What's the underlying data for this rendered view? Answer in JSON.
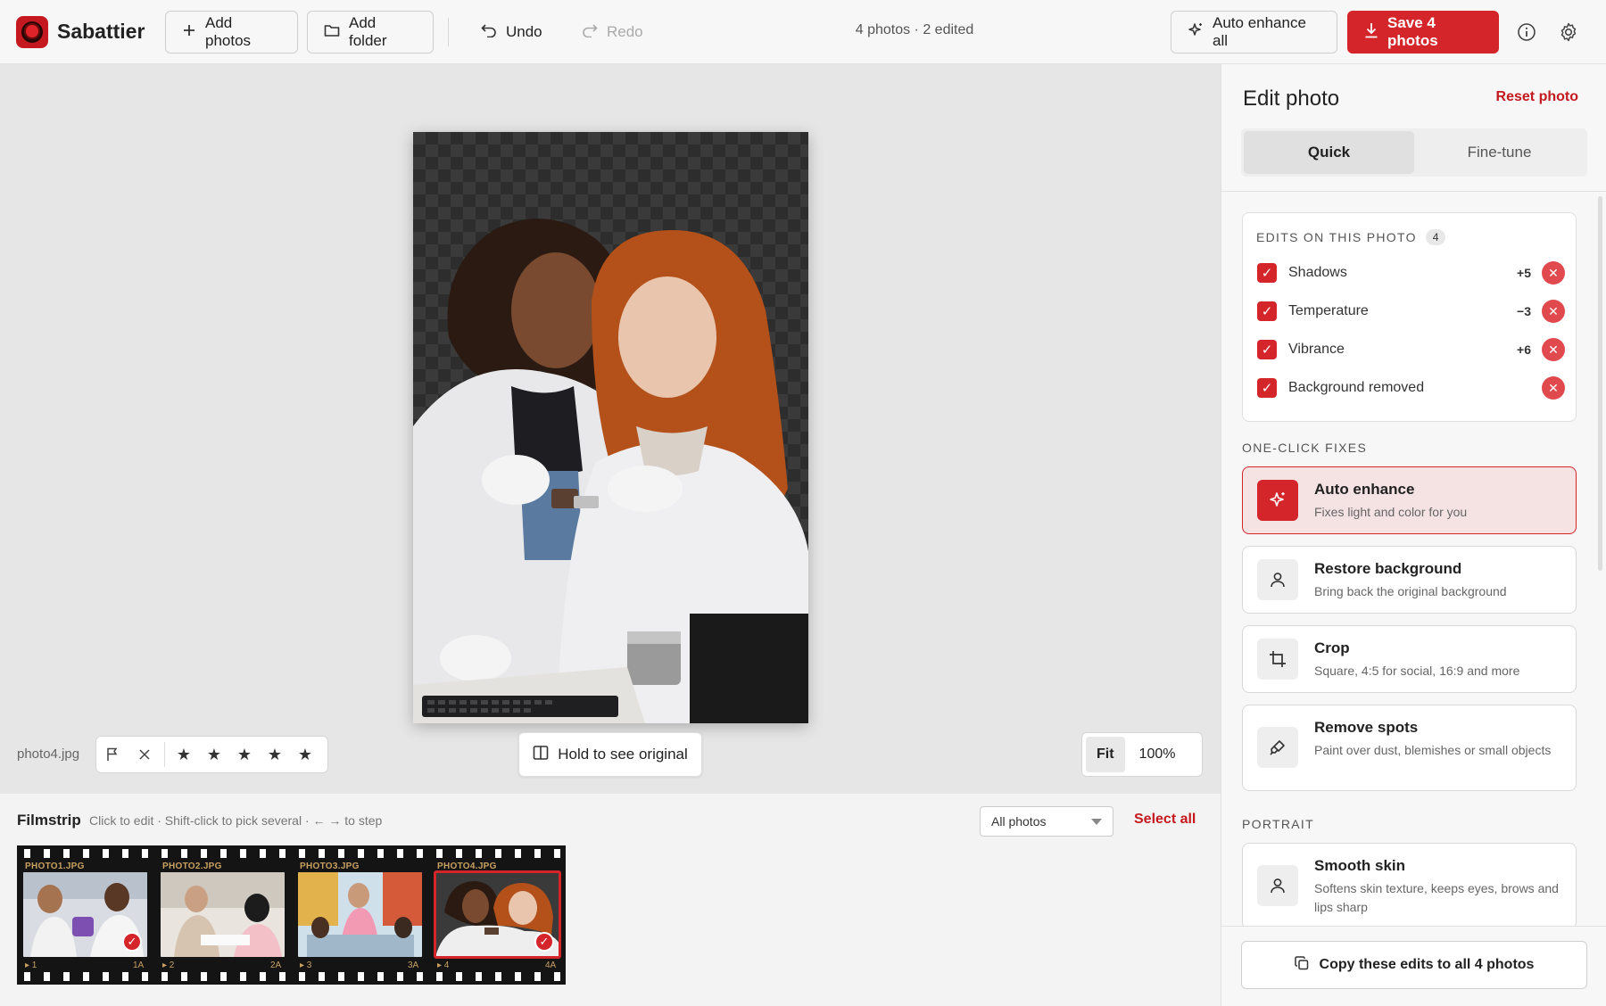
{
  "app": {
    "name": "Sabattier"
  },
  "toolbar": {
    "add_photos": "Add photos",
    "add_folder": "Add folder",
    "undo": "Undo",
    "redo": "Redo",
    "status": "4 photos · 2 edited",
    "auto_enhance_all": "Auto enhance all",
    "save": "Save 4 photos",
    "icons": {
      "add": "plus-icon",
      "folder": "folder-icon",
      "undo": "undo-icon",
      "redo": "redo-icon",
      "auto": "sparkle-icon",
      "save": "download-icon",
      "info": "info-icon",
      "settings": "gear-icon"
    }
  },
  "canvas": {
    "filename": "photo4.jpg",
    "hold_button": "Hold to see original",
    "zoom": {
      "fit": "Fit",
      "percent": "100%"
    },
    "rating": {
      "stars": [
        "★",
        "★",
        "★",
        "★",
        "★"
      ],
      "flag_icon": "flag-icon",
      "reject_icon": "close-icon"
    }
  },
  "filmstrip": {
    "title": "Filmstrip",
    "hint": "Click to edit · Shift-click to pick several · ← → to step",
    "filter": "All photos",
    "select_all": "Select all",
    "frames": [
      {
        "label": "PHOTO1.JPG",
        "num": "▸ 1",
        "num_r": "1A",
        "edited": true,
        "selected": false
      },
      {
        "label": "PHOTO2.JPG",
        "num": "▸ 2",
        "num_r": "2A",
        "edited": false,
        "selected": false
      },
      {
        "label": "PHOTO3.JPG",
        "num": "▸ 3",
        "num_r": "3A",
        "edited": false,
        "selected": false
      },
      {
        "label": "PHOTO4.JPG",
        "num": "▸ 4",
        "num_r": "4A",
        "edited": true,
        "selected": true
      }
    ]
  },
  "panel": {
    "title": "Edit photo",
    "reset": "Reset photo",
    "tabs": [
      "Quick",
      "Fine-tune"
    ],
    "active_tab": "Quick",
    "edits_header": "EDITS ON THIS PHOTO",
    "edits_count": "4",
    "edits": [
      {
        "label": "Shadows",
        "value": "+5"
      },
      {
        "label": "Temperature",
        "value": "−3"
      },
      {
        "label": "Vibrance",
        "value": "+6"
      },
      {
        "label": "Background removed",
        "value": ""
      }
    ],
    "one_click_label": "ONE-CLICK FIXES",
    "fixes": [
      {
        "title": "Auto enhance",
        "sub": "Fixes light and color for you",
        "icon": "sparkle-icon",
        "active": true
      },
      {
        "title": "Restore background",
        "sub": "Bring back the original background",
        "icon": "person-icon",
        "active": false
      },
      {
        "title": "Crop",
        "sub": "Square, 4:5 for social, 16:9 and more",
        "icon": "crop-icon",
        "active": false
      },
      {
        "title": "Remove spots",
        "sub": "Paint over dust, blemishes or small objects",
        "icon": "brush-icon",
        "active": false
      }
    ],
    "portrait_label": "PORTRAIT",
    "portrait": [
      {
        "title": "Smooth skin",
        "sub": "Softens skin texture, keeps eyes, brows and lips sharp",
        "icon": "person-icon"
      }
    ],
    "copy_button": "Copy these edits to all 4 photos",
    "accent": "#d4252a"
  }
}
